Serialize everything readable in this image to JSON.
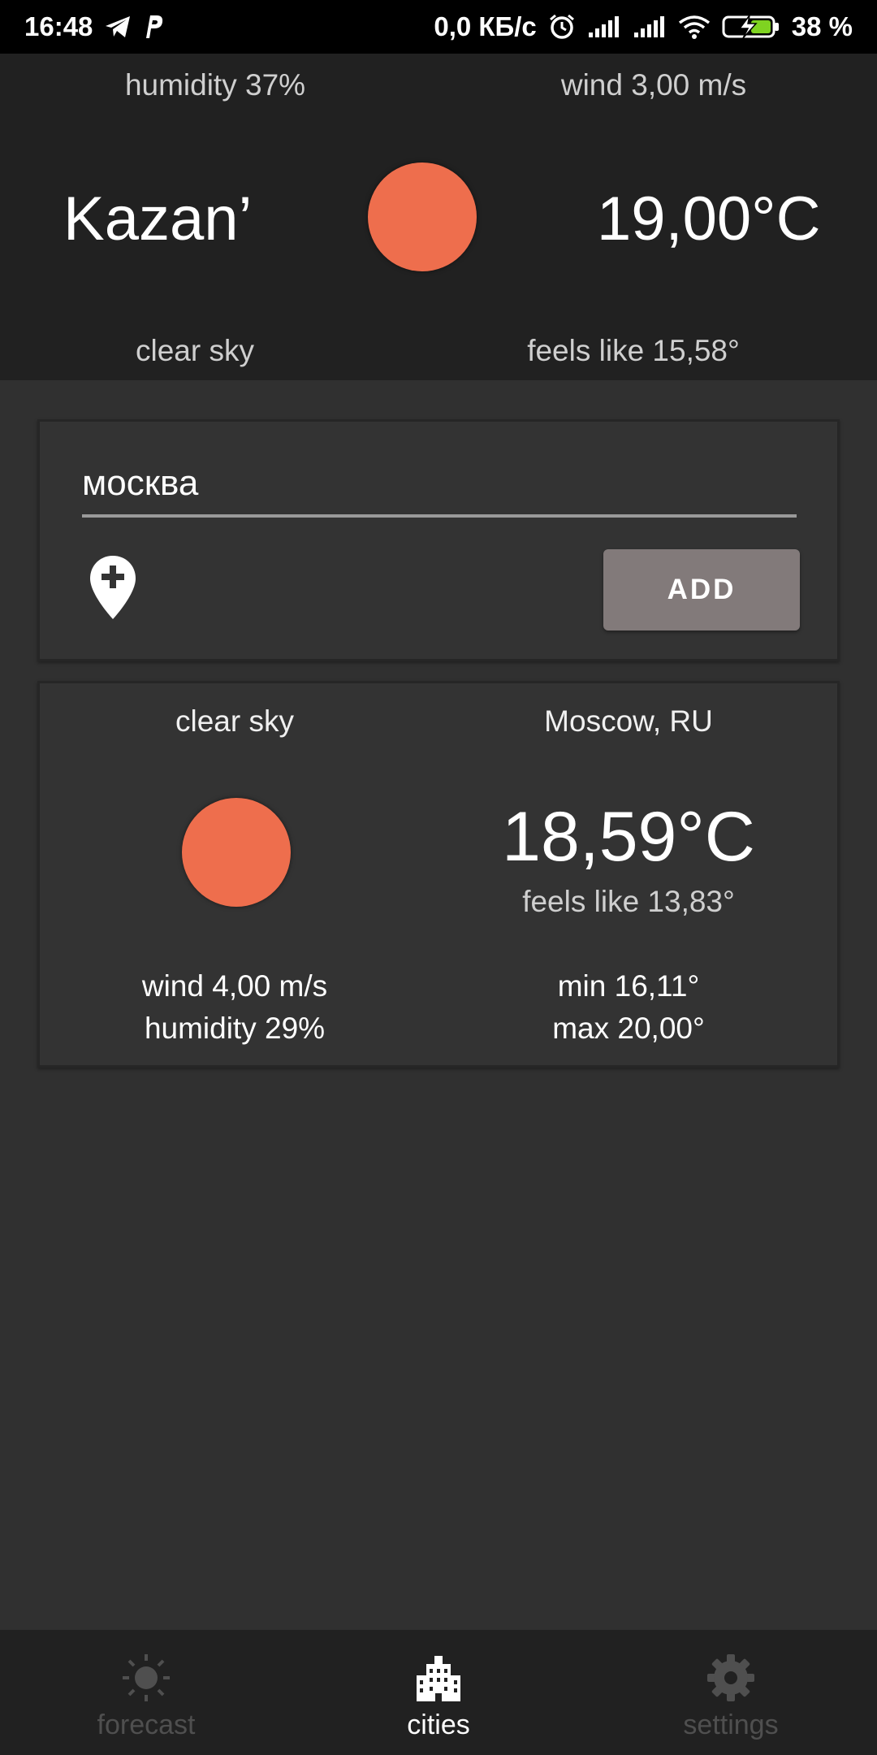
{
  "status_bar": {
    "time": "16:48",
    "speed": "0,0 КБ/с",
    "battery": "38 %",
    "icons": [
      "telegram-icon",
      "p-icon",
      "alarm-icon",
      "signal-icon",
      "signal-icon",
      "wifi-icon",
      "battery-charging-icon"
    ]
  },
  "current": {
    "humidity": "humidity 37%",
    "wind": "wind 3,00 m/s",
    "city": "Kazan’",
    "temp": "19,00°C",
    "description": "clear sky",
    "feels_like": "feels like 15,58°",
    "icon": "sun-icon"
  },
  "add_city": {
    "input_value": "москва",
    "add_label": "ADD",
    "location_icon": "add-location-icon"
  },
  "cities": [
    {
      "description": "clear sky",
      "name": "Moscow, RU",
      "temp": "18,59°C",
      "feels_like": "feels like 13,83°",
      "wind": "wind 4,00 m/s",
      "humidity": "humidity 29%",
      "min": "min 16,11°",
      "max": "max 20,00°",
      "icon": "sun-icon"
    }
  ],
  "nav": {
    "forecast": "forecast",
    "cities": "cities",
    "settings": "settings",
    "active": "cities"
  },
  "colors": {
    "sun": "#ee6e4d",
    "background": "#303030",
    "header": "#212121",
    "add_button": "#827a7a"
  }
}
